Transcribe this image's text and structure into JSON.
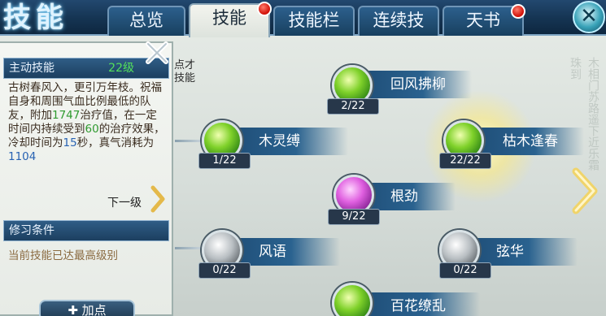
{
  "header": {
    "title": "技能",
    "tabs": [
      {
        "label": "总览",
        "active": false,
        "badge": false
      },
      {
        "label": "技能",
        "active": true,
        "badge": true
      },
      {
        "label": "技能栏",
        "active": false,
        "badge": false
      },
      {
        "label": "连续技",
        "active": false,
        "badge": false
      },
      {
        "label": "天书",
        "active": false,
        "badge": true
      }
    ],
    "close_icon": "x-close-icon"
  },
  "detail": {
    "section_title": "主动技能",
    "level": "22级",
    "desc_1": "古树春风入，更引万年枝。祝福自身和周围气血比例最低的队友，附加",
    "heal_value": "1747",
    "desc_2": "治疗值，在一定时间内持续受到",
    "hot_percent": "60",
    "desc_3": "的治疗效果，冷却时间为",
    "cooldown": "15",
    "desc_4": "秒，真气消耗为",
    "mana_cost": "1104",
    "next_level": "下一级",
    "requirement_title": "修习条件",
    "requirement_text": "当前技能已达最高级别",
    "add_point": "加点",
    "side_note_1": "点才",
    "side_note_2": "技能"
  },
  "skills": [
    {
      "name": "回风拂柳",
      "count": "2/22",
      "icon": "green"
    },
    {
      "name": "木灵缚",
      "count": "1/22",
      "icon": "green"
    },
    {
      "name": "枯木逢春",
      "count": "22/22",
      "icon": "green"
    },
    {
      "name": "根劲",
      "count": "9/22",
      "icon": "pink"
    },
    {
      "name": "风语",
      "count": "0/22",
      "icon": "gray"
    },
    {
      "name": "弦华",
      "count": "0/22",
      "icon": "gray"
    },
    {
      "name": "百花缭乱",
      "count": "",
      "icon": "green"
    }
  ],
  "colors": {
    "accent_green": "#2f9a2f",
    "accent_blue": "#2863b3",
    "badge_red": "#d3140b"
  }
}
